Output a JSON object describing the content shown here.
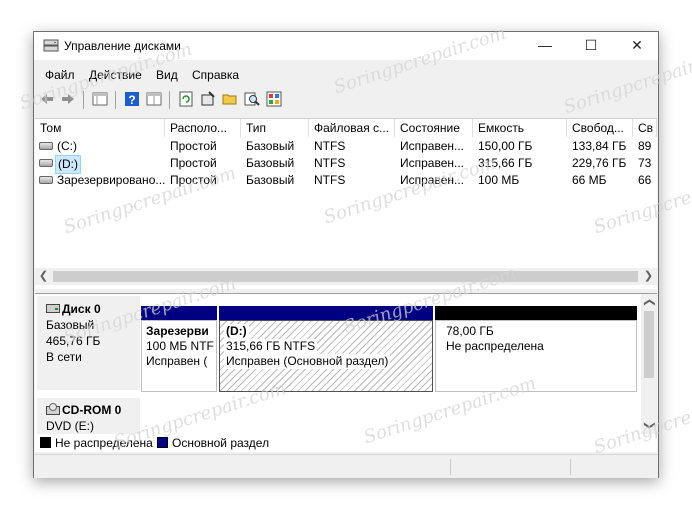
{
  "window": {
    "title": "Управление дисками"
  },
  "window_buttons": [
    "—",
    "☐",
    "✕"
  ],
  "menu": [
    "Файл",
    "Действие",
    "Вид",
    "Справка"
  ],
  "columns": [
    "Том",
    "Располо...",
    "Тип",
    "Файловая с...",
    "Состояние",
    "Емкость",
    "Свобод...",
    "Св"
  ],
  "volumes": [
    {
      "name": "(C:)",
      "layout": "Простой",
      "type": "Базовый",
      "fs": "NTFS",
      "status": "Исправен...",
      "capacity": "150,00 ГБ",
      "free": "133,84 ГБ",
      "pct": "89"
    },
    {
      "name": "(D:)",
      "layout": "Простой",
      "type": "Базовый",
      "fs": "NTFS",
      "status": "Исправен...",
      "capacity": "315,66 ГБ",
      "free": "229,76 ГБ",
      "pct": "73"
    },
    {
      "name": "Зарезервировано...",
      "layout": "Простой",
      "type": "Базовый",
      "fs": "NTFS",
      "status": "Исправен...",
      "capacity": "100 МБ",
      "free": "66 МБ",
      "pct": "66"
    }
  ],
  "disk0": {
    "name": "Диск 0",
    "type": "Базовый",
    "size": "465,76 ГБ",
    "state": "В сети",
    "partitions": [
      {
        "title": "Зарезерви",
        "line1": "100 МБ NTF",
        "line2": "Исправен ("
      },
      {
        "title": "(D:)",
        "line1": "315,66 ГБ NTFS",
        "line2": "Исправен (Основной раздел)"
      },
      {
        "title": "",
        "line1": "78,00 ГБ",
        "line2": "Не распределена"
      }
    ]
  },
  "cdrom": {
    "name": "CD-ROM 0",
    "drive": "DVD (E:)"
  },
  "legend": [
    {
      "label": "Не распределена",
      "color": "#000000"
    },
    {
      "label": "Основной раздел",
      "color": "#000080"
    }
  ],
  "watermark": "Soringpcrepair.com",
  "colors": {
    "primary_partition": "#000080",
    "unallocated": "#000000",
    "selection": "#cce8ff"
  }
}
